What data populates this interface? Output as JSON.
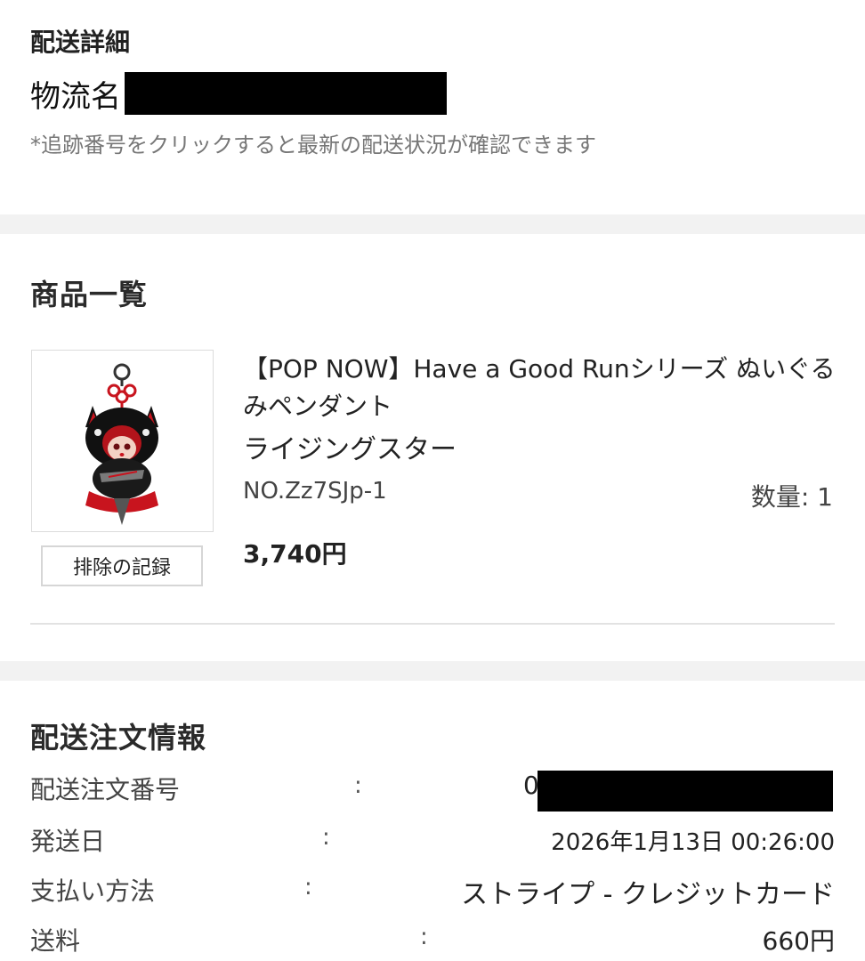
{
  "delivery": {
    "title": "配送詳細",
    "carrier_label": "物流名",
    "tracking_note": "*追跡番号をクリックすると最新の配送状況が確認できます"
  },
  "products": {
    "title": "商品一覧",
    "items": [
      {
        "name": "【POP NOW】Have a Good Runシリーズ ぬいぐるみペンダント",
        "variant": "ライジングスター",
        "sku": "NO.Zz7SJp-1",
        "quantity": "数量: 1",
        "price": "3,740円",
        "action_label": "排除の記録",
        "image_icon": "plush-pendant-image"
      }
    ]
  },
  "order_info": {
    "title": "配送注文情報",
    "rows": [
      {
        "label": "配送注文番号",
        "value": "0"
      },
      {
        "label": "発送日",
        "value": "2026年1月13日 00:26:00"
      },
      {
        "label": "支払い方法",
        "value": "ストライプ - クレジットカード"
      },
      {
        "label": "送料",
        "value": "660円"
      }
    ]
  },
  "colors": {
    "section_band": "#f2f2f2",
    "redaction": "#000000",
    "accent_red": "#c8141e"
  }
}
